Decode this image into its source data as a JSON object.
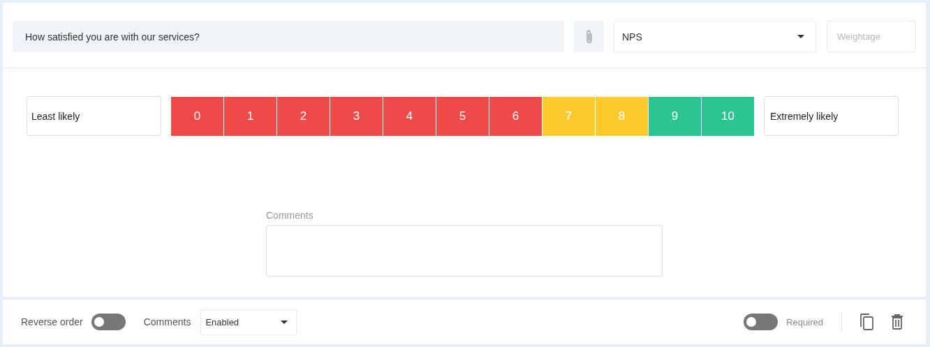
{
  "question": {
    "value": "How satisfied you are with our services?"
  },
  "question_type": {
    "value": "NPS"
  },
  "weightage": {
    "placeholder": "Weightage"
  },
  "scale": {
    "low_label": "Least likely",
    "high_label": "Extremely likely",
    "points": [
      {
        "label": "0",
        "color": "#ef4a4a"
      },
      {
        "label": "1",
        "color": "#ef4a4a"
      },
      {
        "label": "2",
        "color": "#ef4a4a"
      },
      {
        "label": "3",
        "color": "#ef4a4a"
      },
      {
        "label": "4",
        "color": "#ef4a4a"
      },
      {
        "label": "5",
        "color": "#ef4a4a"
      },
      {
        "label": "6",
        "color": "#ef4a4a"
      },
      {
        "label": "7",
        "color": "#fdca2e"
      },
      {
        "label": "8",
        "color": "#fdca2e"
      },
      {
        "label": "9",
        "color": "#2bc592"
      },
      {
        "label": "10",
        "color": "#2bc592"
      }
    ]
  },
  "comments_box": {
    "label": "Comments"
  },
  "footer": {
    "reverse_order": {
      "label": "Reverse order",
      "on": false
    },
    "comments": {
      "label": "Comments",
      "value": "Enabled"
    },
    "required": {
      "label": "Required",
      "on": false
    }
  }
}
